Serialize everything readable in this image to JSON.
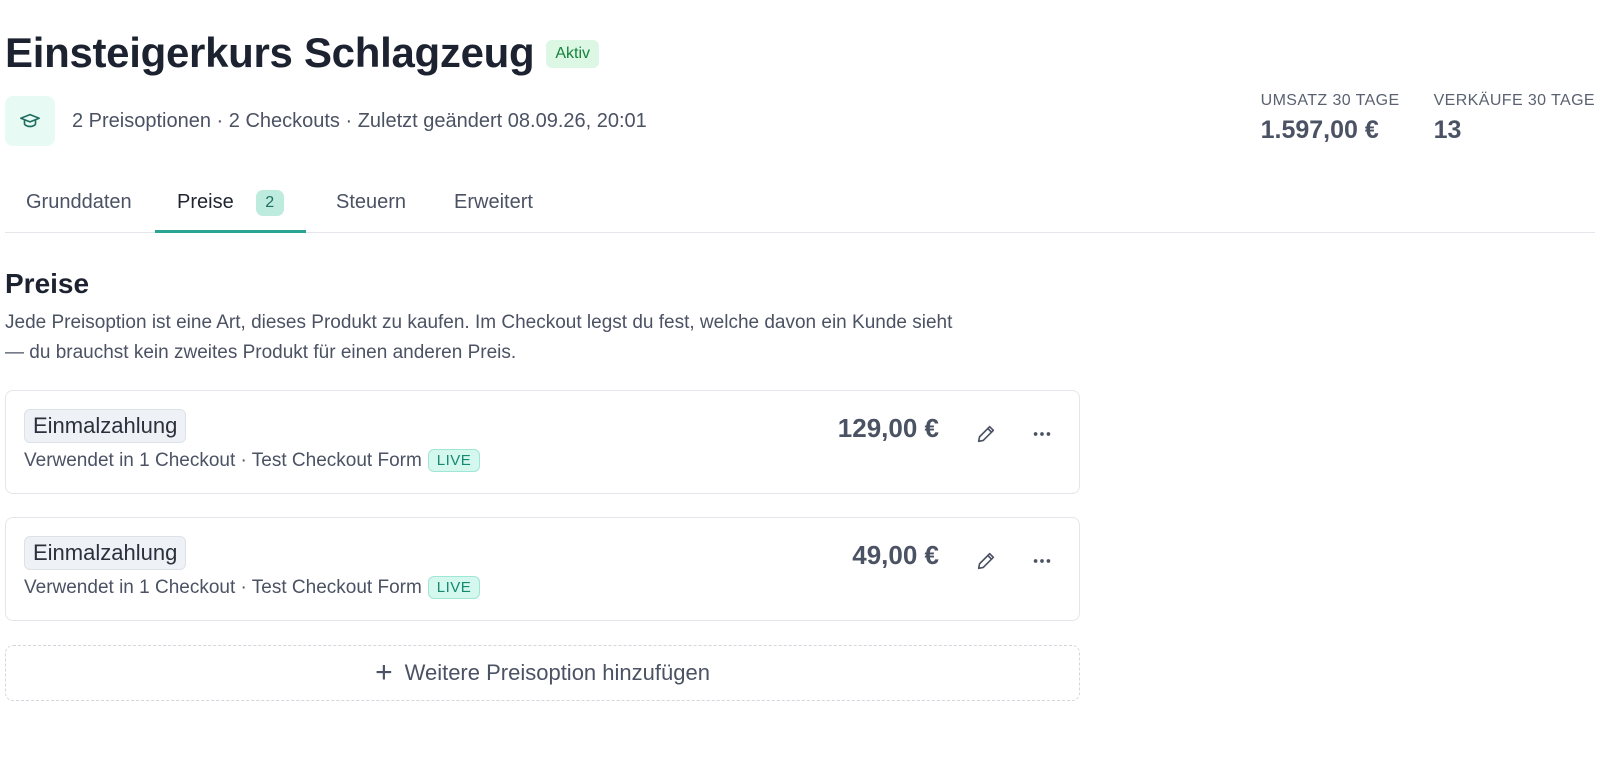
{
  "product": {
    "title": "Einsteigerkurs Schlagzeug",
    "status": "Aktiv",
    "icon": "graduation-cap-icon",
    "meta": "2 Preisoptionen · 2 Checkouts · Zuletzt geändert 08.09.26, 20:01"
  },
  "stats": [
    {
      "label": "UMSATZ 30 TAGE",
      "value": "1.597,00 €"
    },
    {
      "label": "VERKÄUFE 30 TAGE",
      "value": "13"
    }
  ],
  "tabs": [
    {
      "label": "Grunddaten"
    },
    {
      "label": "Preise",
      "count": "2",
      "active": true
    },
    {
      "label": "Steuern"
    },
    {
      "label": "Erweitert"
    }
  ],
  "section": {
    "title": "Preise",
    "description": "Jede Preisoption ist eine Art, dieses Produkt zu kaufen. Im Checkout legst du fest, welche davon ein Kunde sieht — du brauchst kein zweites Produkt für einen anderen Preis."
  },
  "price_options": [
    {
      "type": "Einmalzahlung",
      "usage": "Verwendet in 1 Checkout · Test Checkout Form",
      "badge": "LIVE",
      "price": "129,00 €"
    },
    {
      "type": "Einmalzahlung",
      "usage": "Verwendet in 1 Checkout · Test Checkout Form",
      "badge": "LIVE",
      "price": "49,00 €"
    }
  ],
  "add_button": {
    "label": "Weitere Preisoption hinzufügen"
  },
  "colors": {
    "accent": "#2ba592",
    "status_active": "#17823c",
    "live": "#148a73"
  }
}
